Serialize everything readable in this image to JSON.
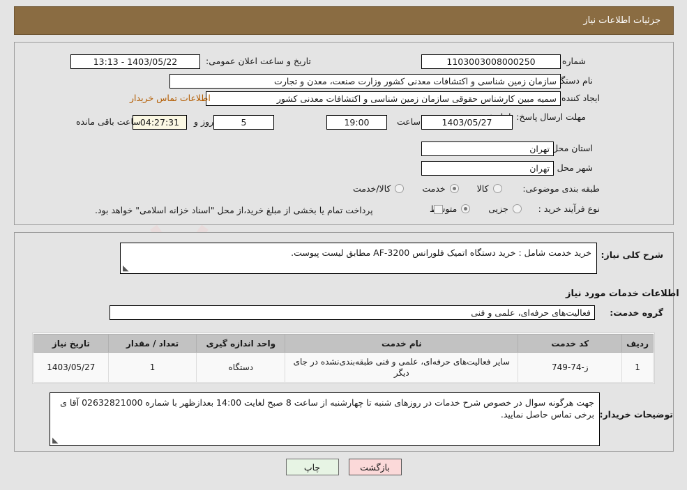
{
  "header": {
    "title": "جزئیات اطلاعات نیاز"
  },
  "colors": {
    "header_bg": "#8a6c42",
    "link": "#b35c00",
    "timer_bg": "#fbf8e3",
    "print_btn_bg": "#e7f4e4",
    "back_btn_bg": "#fbd9d9"
  },
  "top_panel": {
    "need_number_label": "شماره نیاز:",
    "need_number_value": "1103003008000250",
    "announce_datetime_label": "تاریخ و ساعت اعلان عمومی:",
    "announce_datetime_value": "1403/05/22 - 13:13",
    "buyer_org_label": "نام دستگاه خریدار:",
    "buyer_org_value": "سازمان زمین شناسی و اکتشافات معدنی کشور وزارت صنعت، معدن و تجارت",
    "requester_label": "ایجاد کننده درخواست:",
    "requester_value": "سمیه مبین کارشناس حقوقی سازمان زمین شناسی و اکتشافات معدنی کشور",
    "buyer_contact_link": "اطلاعات تماس خریدار",
    "deadline_label": "مهلت ارسال پاسخ: تا تاریخ:",
    "deadline_date": "1403/05/27",
    "deadline_hour_label": "ساعت",
    "deadline_hour": "19:00",
    "remaining_days": "5",
    "remaining_days_suffix": "روز و",
    "remaining_time": "04:27:31",
    "remaining_time_suffix": "ساعت باقی مانده",
    "province_label": "استان محل تحویل:",
    "province_value": "تهران",
    "city_label": "شهر محل تحویل:",
    "city_value": "تهران",
    "category_label": "طبقه بندی موضوعی:",
    "category_options": [
      {
        "label": "کالا",
        "selected": false
      },
      {
        "label": "خدمت",
        "selected": true
      },
      {
        "label": "کالا/خدمت",
        "selected": false
      }
    ],
    "process_label": "نوع فرآیند خرید :",
    "process_options": [
      {
        "label": "جزیی",
        "selected": false
      },
      {
        "label": "متوسط",
        "selected": true
      }
    ],
    "treasury_checkbox_checked": false,
    "treasury_note": "پرداخت تمام یا بخشی از مبلغ خرید،از محل \"اسناد خزانه اسلامی\" خواهد بود."
  },
  "bottom_panel": {
    "general_desc_label": "شرح کلی نیاز:",
    "general_desc_value": "خرید خدمت شامل : خرید دستگاه اتمیک  فلورانس AF-3200 مطابق لیست پیوست.",
    "services_section_title": "اطلاعات خدمات مورد نیاز",
    "service_group_label": "گروه خدمت:",
    "service_group_value": "فعالیت‌های حرفه‌ای، علمی و فنی",
    "table": {
      "columns": [
        "ردیف",
        "کد خدمت",
        "نام خدمت",
        "واحد اندازه گیری",
        "تعداد / مقدار",
        "تاریخ نیاز"
      ],
      "rows": [
        {
          "radif": "1",
          "code": "ز-74-749",
          "name": "سایر فعالیت‌های حرفه‌ای، علمی و فنی طبقه‌بندی‌نشده در جای دیگر",
          "unit": "دستگاه",
          "qty": "1",
          "date": "1403/05/27"
        }
      ]
    },
    "buyer_notes_label": "توضیحات خریدار:",
    "buyer_notes_value": "جهت هرگونه سوال در خصوص شرح خدمات در روزهای شنبه تا چهارشنبه از ساعت 8 صبح لغایت 14:00 بعدازظهر با شماره 02632821000 آقا ی برخی تماس حاصل نمایید."
  },
  "buttons": {
    "print": "چاپ",
    "back": "بازگشت"
  },
  "watermark": {
    "text": "AriaTender.net"
  }
}
